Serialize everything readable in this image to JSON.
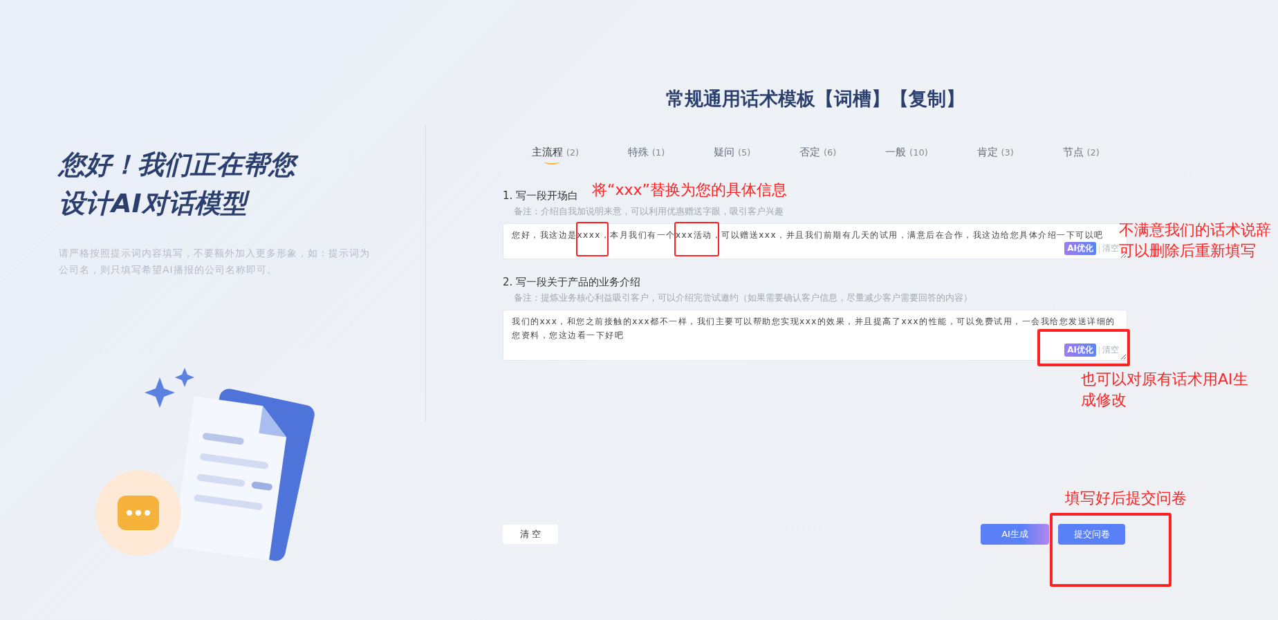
{
  "intro": {
    "heading_lines": [
      "您好！我们正在帮您",
      "设计AI对话模型"
    ],
    "hint": "请严格按照提示词内容填写，不要额外加入更多形象，如：提示词为公司名，则只填写希望AI播报的公司名称即可。"
  },
  "title": "常规通用话术模板【词槽】【复制】",
  "tabs": [
    {
      "label": "主流程",
      "count": "(2)",
      "selected": true
    },
    {
      "label": "特殊",
      "count": "(1)",
      "selected": false
    },
    {
      "label": "疑问",
      "count": "(5)",
      "selected": false
    },
    {
      "label": "否定",
      "count": "(6)",
      "selected": false
    },
    {
      "label": "一般",
      "count": "(10)",
      "selected": false
    },
    {
      "label": "肯定",
      "count": "(3)",
      "selected": false
    },
    {
      "label": "节点",
      "count": "(2)",
      "selected": false
    }
  ],
  "questions": [
    {
      "label": "1. 写一段开场白",
      "note": "备注：介绍自我加说明来意，可以利用优惠赠送字眼，吸引客户兴趣",
      "value": "您好，我这边是xxxx，本月我们有一个xxx活动，可以赠送xxx，并且我们前期有几天的试用，满意后在合作，我这边给您具体介绍一下可以吧",
      "optimize": "AI优化",
      "clear": "清空"
    },
    {
      "label": "2. 写一段关于产品的业务介绍",
      "note": "备注：提炼业务核心利益吸引客户，可以介绍完尝试邀约（如果需要确认客户信息，尽量减少客户需要回答的内容）",
      "value": "我们的xxx，和您之前接触的xxx都不一样，我们主要可以帮助您实现xxx的效果，并且提高了xxx的性能，可以免费试用，一会我给您发送详细的您资料，您这边看一下好吧",
      "optimize": "AI优化",
      "clear": "清空"
    }
  ],
  "buttons": {
    "clear": "清 空",
    "generate": "AI生成",
    "submit": "提交问卷"
  },
  "annotations": [
    "将“xxx”替换为您的具体信息",
    "不满意我们的话术说辞可以删除后重新填写",
    "也可以对原有话术用AI生成修改",
    "填写好后提交问卷"
  ]
}
